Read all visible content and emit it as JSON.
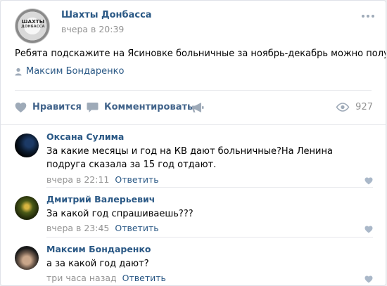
{
  "post": {
    "group_name": "Шахты Донбасса",
    "group_logo_line1": "ШАХТЫ",
    "group_logo_line2": "ДОНБАССА",
    "time": "вчера в 20:39",
    "text": "Ребята подскажите на Ясиновке больничные за ноябрь-декабрь можно получить?",
    "signer": "Максим Бондаренко"
  },
  "actions": {
    "like_label": "Нравится",
    "comment_label": "Комментировать",
    "views": "927"
  },
  "comments": [
    {
      "author": "Оксана Сулима",
      "text": "За какие месяцы и год на КВ дают больничные?На Ленина подруга сказала за 15 год отдают.",
      "time": "вчера в 22:11",
      "reply_label": "Ответить"
    },
    {
      "author": "Дмитрий Валерьевич",
      "text": "За какой год спрашиваешь???",
      "time": "вчера в 23:45",
      "reply_label": "Ответить"
    },
    {
      "author": "Максим Бондаренко",
      "text": "а за какой год дают?",
      "time": "три часа назад",
      "reply_label": "Ответить"
    }
  ],
  "colors": {
    "link": "#2a5885",
    "action": "#42648b",
    "muted": "#939393",
    "icon": "#9eaab8"
  },
  "icons": [
    "more-icon",
    "user-icon",
    "heart-icon",
    "comment-icon",
    "megaphone-icon",
    "eye-icon"
  ]
}
